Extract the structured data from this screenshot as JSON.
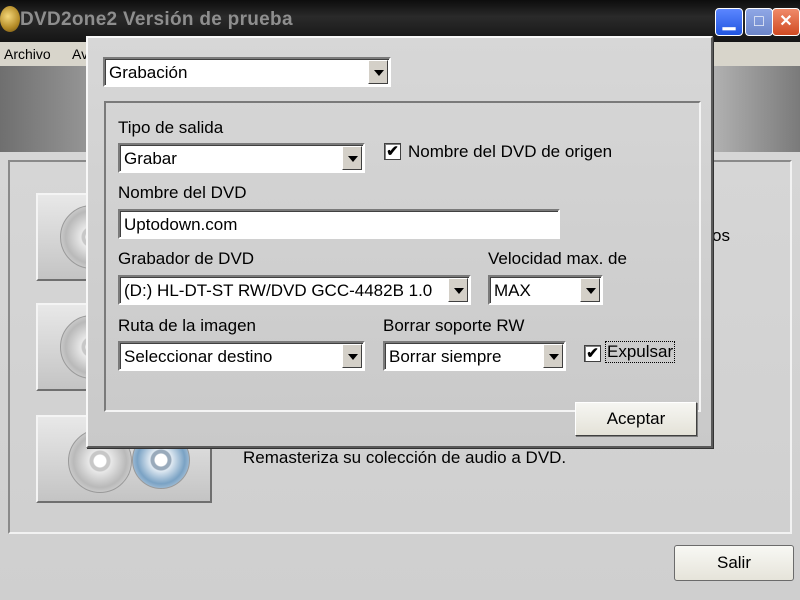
{
  "window": {
    "title": "DVD2one2 Versión de prueba",
    "controls": {
      "minimize": "▁",
      "maximize": "□",
      "close": "✕"
    }
  },
  "menu": {
    "items": [
      "Archivo",
      "Av"
    ]
  },
  "main": {
    "partial_text": "os",
    "remaster_text": "Remasteriza su colección de audio a DVD.",
    "exit_label": "Salir"
  },
  "dialog": {
    "section": "Grabación",
    "output_type_label": "Tipo de salida",
    "output_type_value": "Grabar",
    "origin_name_checkbox": {
      "label": "Nombre del DVD de origen",
      "checked": true
    },
    "dvd_name_label": "Nombre del DVD",
    "dvd_name_value": "Uptodown.com",
    "recorder_label": "Grabador de DVD",
    "recorder_value": "(D:) HL-DT-ST RW/DVD GCC-4482B 1.0",
    "speed_label": "Velocidad max. de",
    "speed_value": "MAX",
    "image_path_label": "Ruta de la imagen",
    "image_path_value": "Seleccionar destino",
    "erase_label": "Borrar soporte RW",
    "erase_value": "Borrar siempre",
    "eject_checkbox": {
      "label": "Expulsar",
      "checked": true
    },
    "accept_label": "Aceptar",
    "check_mark": "✔"
  },
  "colors": {
    "titlebar": "#151515",
    "accent": "#2155e0"
  }
}
